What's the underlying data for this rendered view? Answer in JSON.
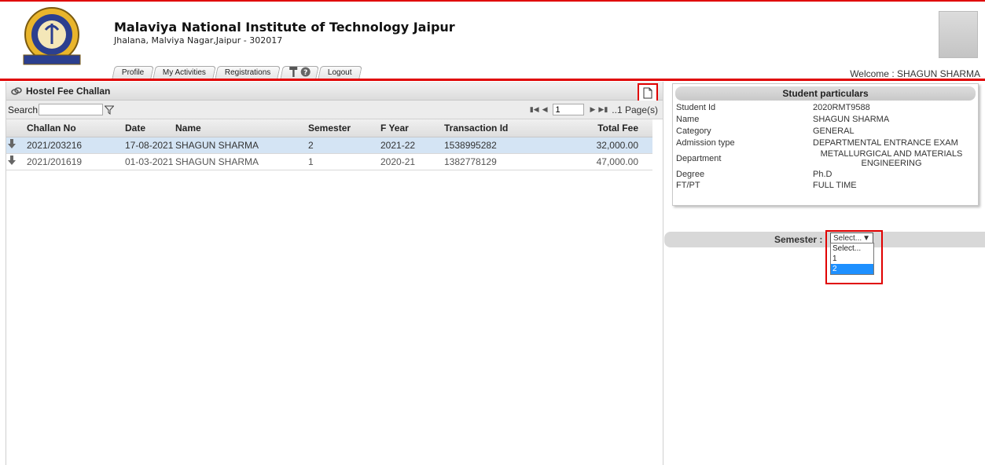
{
  "header": {
    "institute_name": "Malaviya National Institute of Technology Jaipur",
    "institute_address": "Jhalana, Malviya Nagar,Jaipur - 302017",
    "welcome": "Welcome : SHAGUN SHARMA"
  },
  "tabs": [
    "Profile",
    "My Activities",
    "Registrations",
    "Logout"
  ],
  "panel": {
    "title": "Hostel Fee Challan",
    "search_label": "Search",
    "search_value": "",
    "page_value": "1",
    "page_count": "..1 Page(s)"
  },
  "grid": {
    "columns": [
      "Challan No",
      "Date",
      "Name",
      "Semester",
      "F Year",
      "Transaction Id",
      "Total Fee"
    ],
    "rows": [
      {
        "challan": "2021/203216",
        "date": "17-08-2021",
        "name": "SHAGUN SHARMA",
        "semester": "2",
        "fyear": "2021-22",
        "txn": "1538995282",
        "fee": "32,000.00"
      },
      {
        "challan": "2021/201619",
        "date": "01-03-2021",
        "name": "SHAGUN SHARMA",
        "semester": "1",
        "fyear": "2020-21",
        "txn": "1382778129",
        "fee": "47,000.00"
      }
    ]
  },
  "student": {
    "title": "Student particulars",
    "fields": [
      {
        "label": "Student Id",
        "value": "2020RMT9588"
      },
      {
        "label": "Name",
        "value": "SHAGUN SHARMA"
      },
      {
        "label": "Category",
        "value": "GENERAL"
      },
      {
        "label": "Admission type",
        "value": "DEPARTMENTAL ENTRANCE EXAM"
      },
      {
        "label": "Department",
        "value": "METALLURGICAL AND MATERIALS ENGINEERING"
      },
      {
        "label": "Degree",
        "value": "Ph.D"
      },
      {
        "label": "FT/PT",
        "value": "FULL TIME"
      }
    ]
  },
  "semester": {
    "label": "Semester :",
    "selected": "Select...",
    "options": [
      "Select...",
      "1",
      "2"
    ],
    "highlighted_option": "2"
  },
  "colors": {
    "accent_red": "#e00000",
    "selected_row": "#d4e4f4",
    "option_highlight": "#1e90ff"
  }
}
